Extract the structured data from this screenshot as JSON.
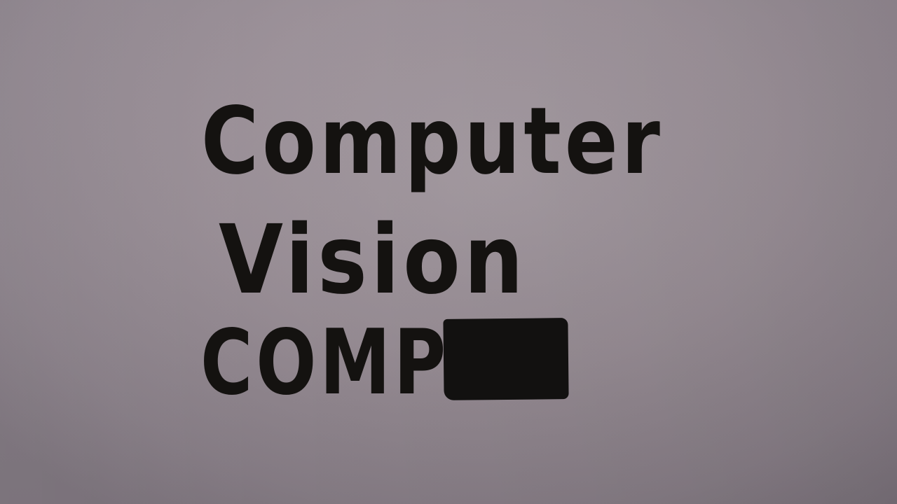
{
  "handwritten_note": {
    "lines": [
      "Computer",
      "Vision",
      "COMP"
    ]
  },
  "colors": {
    "ink": "#141210",
    "paper": "#9a8f97"
  }
}
